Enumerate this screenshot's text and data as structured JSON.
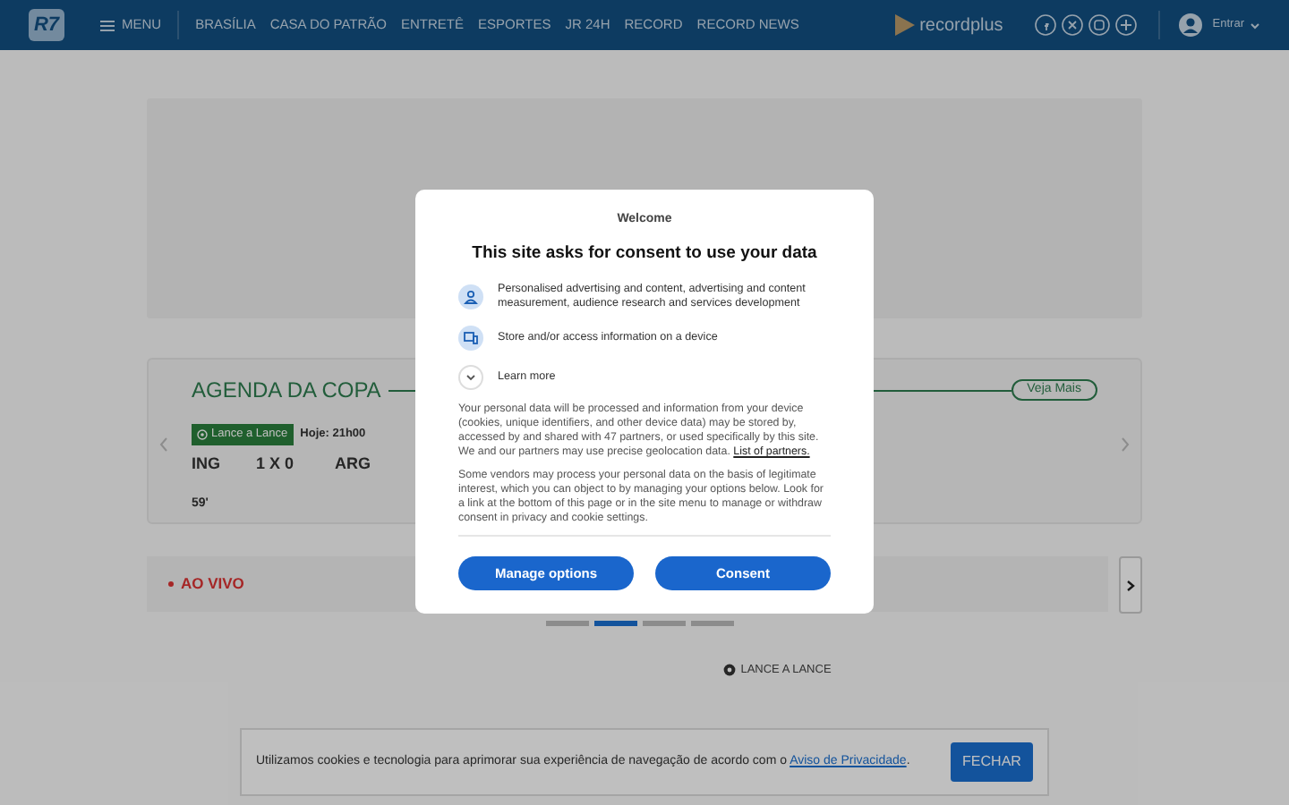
{
  "header": {
    "logo": "R7",
    "menu": "MENU",
    "nav": [
      "BRASÍLIA",
      "CASA DO PATRÃO",
      "ENTRETÊ",
      "ESPORTES",
      "JR 24H",
      "RECORD",
      "RECORD NEWS"
    ],
    "brand": "recordplus",
    "login": "Entrar"
  },
  "agenda": {
    "title": "AGENDA DA COPA",
    "more": "Veja Mais",
    "badge": "Lance a Lance",
    "time": "Hoje: 21h00",
    "home": "ING",
    "score": "1 X 0",
    "away": "ARG",
    "minute": "59'"
  },
  "live": {
    "label": "AO VIVO"
  },
  "carousel": {
    "dots": [
      {
        "selected": false
      },
      {
        "selected": true
      },
      {
        "selected": false
      },
      {
        "selected": false
      }
    ]
  },
  "lance": "LANCE A LANCE",
  "cookie_bar": {
    "text": "Utilizamos cookies e tecnologia para aprimorar sua experiência de navegação de acordo com o",
    "link": "Aviso de Privacidade",
    "after": ".",
    "button": "FECHAR"
  },
  "consent": {
    "welcome": "Welcome",
    "title": "This site asks for consent to use your data",
    "purposes": [
      {
        "kind": "person",
        "text": "Personalised advertising and content, advertising and content measurement, audience research and services development"
      },
      {
        "kind": "device",
        "text": "Store and/or access information on a device"
      },
      {
        "kind": "expand",
        "text": "Learn more"
      }
    ],
    "paragraph1": "Your personal data will be processed and information from your device (cookies, unique identifiers, and other device data) may be stored by, accessed by and shared with 47 partners, or used specifically by this site. We and our partners may use precise geolocation data.",
    "partners_link": "List of partners.",
    "paragraph2": "Some vendors may process your personal data on the basis of legitimate interest, which you can object to by managing your options below. Look for a link at the bottom of this page or in the site menu to manage or withdraw consent in privacy and cookie settings.",
    "buttons": [
      "Manage options",
      "Consent"
    ]
  }
}
